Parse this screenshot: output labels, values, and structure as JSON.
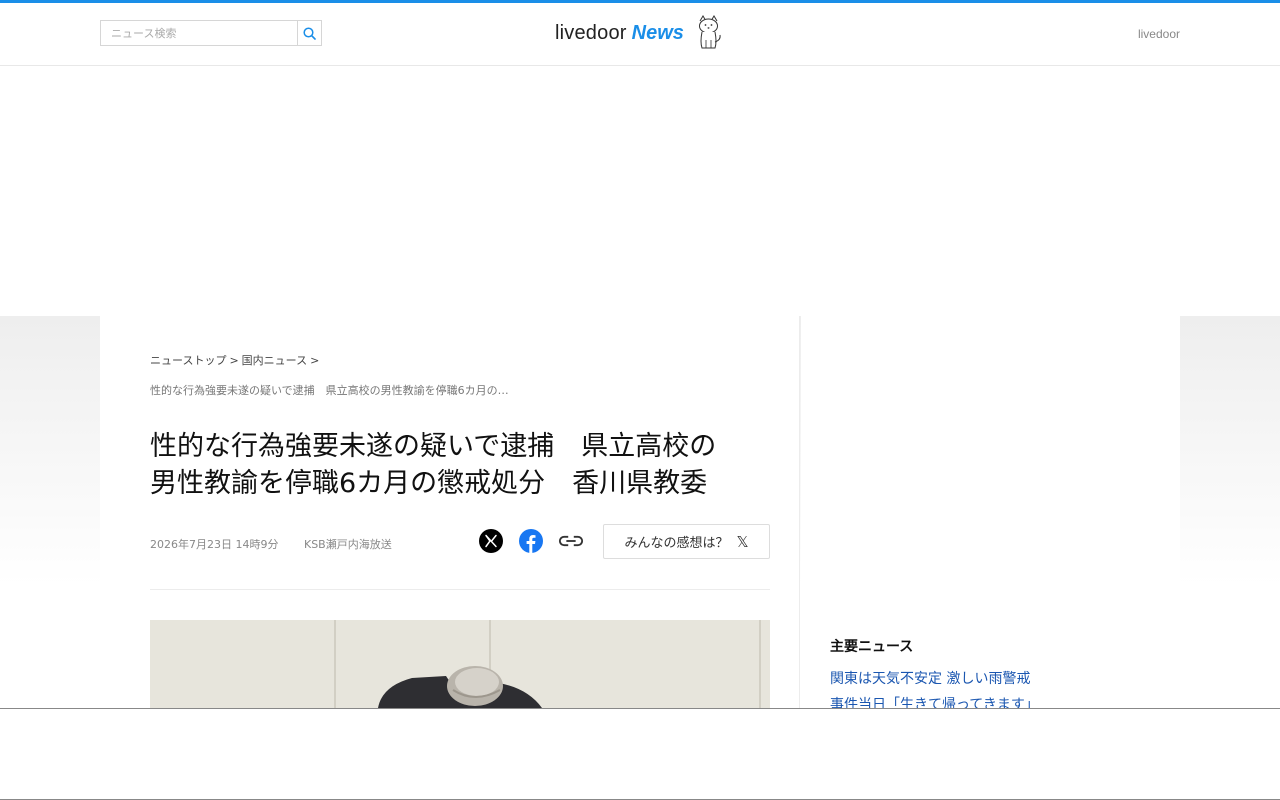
{
  "header": {
    "search_placeholder": "ニュース検索",
    "logo_text": "livedoor",
    "logo_accent": "News",
    "right_link": "livedoor",
    "accent_color": "#1a8ee8"
  },
  "breadcrumb": {
    "items": [
      "ニューストップ",
      "国内ニュース"
    ],
    "separator": ">",
    "current": "性的な行為強要未遂の疑いで逮捕　県立高校の男性教諭を停職6カ月の…"
  },
  "article": {
    "title_line1": "性的な行為強要未遂の疑いで逮捕　県立高校の",
    "title_line2": "男性教諭を停職6カ月の懲戒処分　香川県教委",
    "date": "2026年7月23日 14時9分",
    "source": "KSB瀬戸内海放送",
    "share_icons": [
      "x-icon",
      "facebook-icon",
      "link-icon"
    ],
    "reaction_button": "みんなの感想は？",
    "reaction_icon": "𝕏"
  },
  "sidebar": {
    "heading": "主要ニュース",
    "links": [
      "関東は天気不安定 激しい雨警戒",
      "事件当日「生きて帰ってきます」"
    ]
  }
}
